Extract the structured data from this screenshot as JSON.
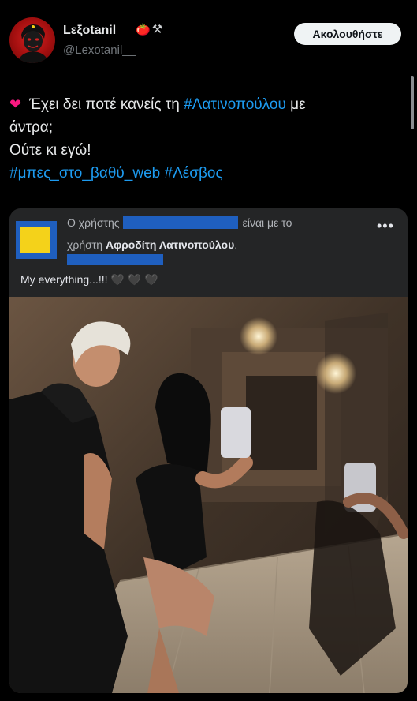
{
  "author": {
    "name": "Lεξotanil",
    "badges": [
      "🍅",
      "⚒"
    ],
    "handle": "@Lexotanil__"
  },
  "follow_button": {
    "label": "Ακολουθήστε"
  },
  "tweet": {
    "heart": "❤",
    "line1_text": "Έχει δει ποτέ κανείς τη ",
    "line1_hashtag": "#Λατινοπούλου",
    "line1_end": " με",
    "line2": "άντρα;",
    "line3": "Ούτε κι εγώ!",
    "hashtag_a": "#μπες_στο_βαθύ_web",
    "hashtag_b": "#Λέσβος"
  },
  "embedded_post": {
    "line1_start": "Ο χρήστης",
    "line1_end": "είναι με το",
    "line2_start": "χρήστη ",
    "tagged_user": "Αφροδίτη Λατινοπούλου",
    "line2_end": ".",
    "more": "•••",
    "caption": "My everything...!!! 🖤 🖤 🖤"
  },
  "colors": {
    "background": "#000000",
    "link": "#1d9bf0",
    "card_bg": "#242526",
    "redaction": "#1f5fbf"
  }
}
